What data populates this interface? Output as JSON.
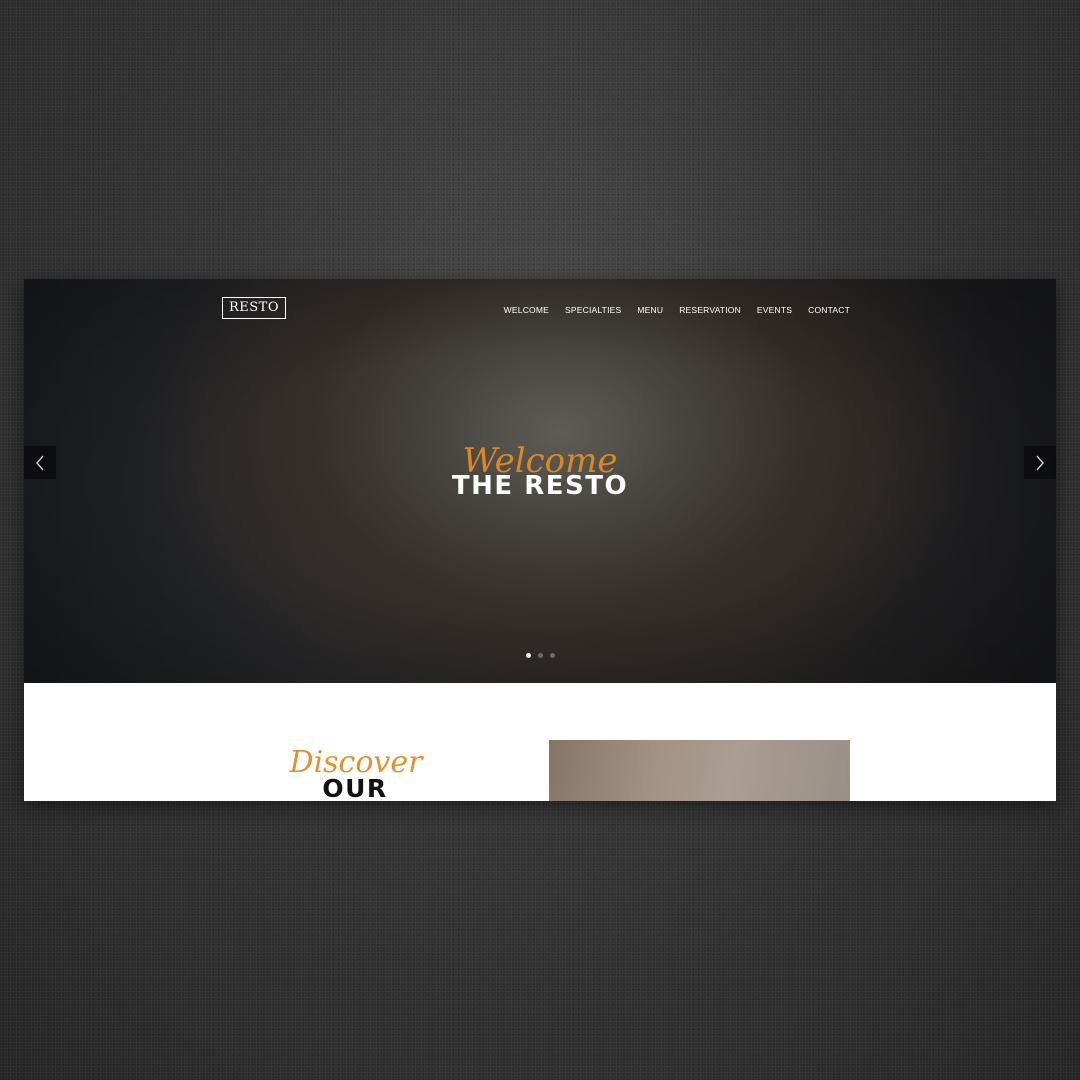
{
  "brand": {
    "logo_text": "RESTO"
  },
  "nav": {
    "items": [
      "WELCOME",
      "SPECIALTIES",
      "MENU",
      "RESERVATION",
      "EVENTS",
      "CONTACT"
    ]
  },
  "hero": {
    "script_text": "Welcome",
    "title": "THE RESTO",
    "slides": {
      "count": 3,
      "active_index": 0
    },
    "prev_icon": "chevron-left-icon",
    "next_icon": "chevron-right-icon"
  },
  "store": {
    "script_text": "Discover",
    "title": "OUR STORE"
  },
  "colors": {
    "accent": "#e38b24",
    "hero_bg": "#2a2a2c",
    "page_bg": "#ffffff",
    "backdrop": "#353535"
  }
}
